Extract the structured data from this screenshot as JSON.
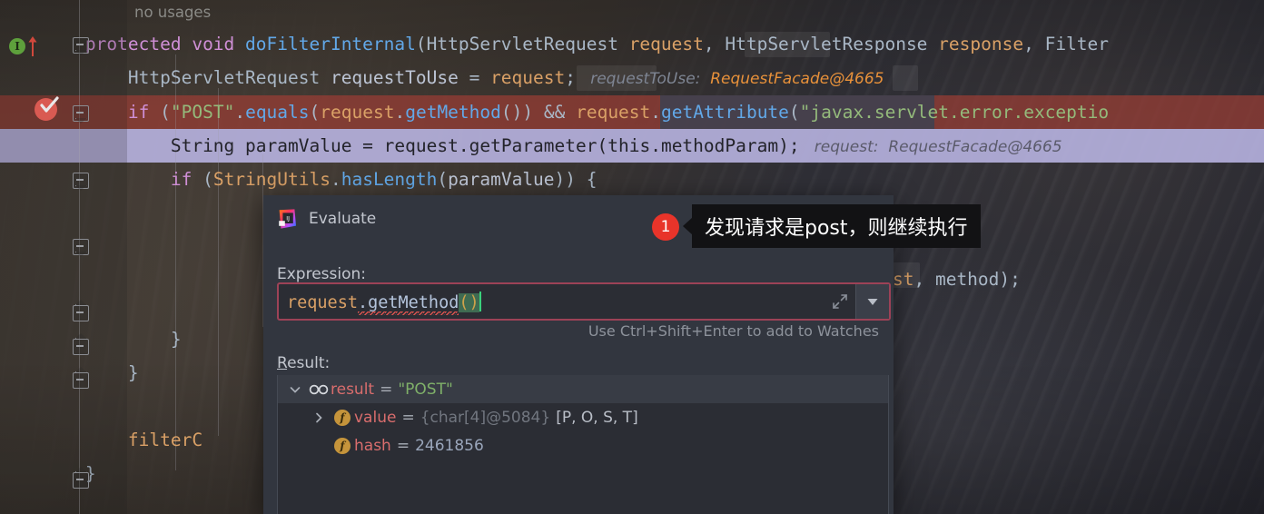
{
  "editor": {
    "inlay_no_usages": "no usages",
    "lines": [
      {
        "id": "signature",
        "segments": [
          {
            "t": "        ",
            "c": "ind"
          },
          {
            "t": "protected ",
            "c": "kw"
          },
          {
            "t": "void ",
            "c": "kw"
          },
          {
            "t": "doFilterInternal",
            "c": "fn"
          },
          {
            "t": "(",
            "c": "punct"
          },
          {
            "t": "HttpServletRequest ",
            "c": "type"
          },
          {
            "t": "request",
            "c": "param"
          },
          {
            "t": ", ",
            "c": "punct"
          },
          {
            "t": "HttpServletResponse ",
            "c": "type"
          },
          {
            "t": "response",
            "c": "param"
          },
          {
            "t": ", ",
            "c": "punct"
          },
          {
            "t": "Filter",
            "c": "type"
          }
        ]
      },
      {
        "id": "requestToUse",
        "segments": [
          {
            "t": "            ",
            "c": "ind"
          },
          {
            "t": "HttpServletRequest ",
            "c": "type"
          },
          {
            "t": "requestToUse ",
            "c": "plain"
          },
          {
            "t": "= ",
            "c": "punct"
          },
          {
            "t": "request",
            "c": "param"
          },
          {
            "t": ";",
            "c": "punct"
          },
          {
            "t": "   requestToUse:  ",
            "c": "hint"
          },
          {
            "t": "RequestFacade@4665",
            "c": "hintval"
          }
        ]
      },
      {
        "id": "if-post",
        "segments": [
          {
            "t": "            ",
            "c": "ind"
          },
          {
            "t": "if ",
            "c": "kw"
          },
          {
            "t": "(",
            "c": "punct"
          },
          {
            "t": "\"POST\"",
            "c": "str"
          },
          {
            "t": ".",
            "c": "punct"
          },
          {
            "t": "equals",
            "c": "fn"
          },
          {
            "t": "(",
            "c": "punct"
          },
          {
            "t": "request",
            "c": "param"
          },
          {
            "t": ".",
            "c": "punct"
          },
          {
            "t": "getMethod",
            "c": "fn"
          },
          {
            "t": "()) ",
            "c": "punct"
          },
          {
            "t": "&& ",
            "c": "punct"
          },
          {
            "t": "request",
            "c": "param"
          },
          {
            "t": ".",
            "c": "punct"
          },
          {
            "t": "getAttribute",
            "c": "fn"
          },
          {
            "t": "(",
            "c": "punct"
          },
          {
            "t": "\"javax.servlet.error.exceptio",
            "c": "str"
          }
        ]
      },
      {
        "id": "paramValue",
        "segments": [
          {
            "t": "                ",
            "c": "ind"
          },
          {
            "t": "String ",
            "c": "type"
          },
          {
            "t": "paramValue ",
            "c": "plain"
          },
          {
            "t": "= ",
            "c": "punct"
          },
          {
            "t": "request",
            "c": "param"
          },
          {
            "t": ".",
            "c": "punct"
          },
          {
            "t": "getParameter",
            "c": "plain"
          },
          {
            "t": "(",
            "c": "punct"
          },
          {
            "t": "this",
            "c": "plain"
          },
          {
            "t": ".",
            "c": "punct"
          },
          {
            "t": "methodParam",
            "c": "plain"
          },
          {
            "t": ");",
            "c": "punct"
          },
          {
            "t": "   request:  ",
            "c": "hint"
          },
          {
            "t": "RequestFacade@4665",
            "c": "hintval2"
          }
        ]
      },
      {
        "id": "if-haslength",
        "segments": [
          {
            "t": "                ",
            "c": "ind"
          },
          {
            "t": "if ",
            "c": "kw"
          },
          {
            "t": "(",
            "c": "punct"
          },
          {
            "t": "StringUtils",
            "c": "param"
          },
          {
            "t": ".",
            "c": "punct"
          },
          {
            "t": "hasLength",
            "c": "fn"
          },
          {
            "t": "(",
            "c": "punct"
          },
          {
            "t": "paramValue",
            "c": "plain"
          },
          {
            "t": ")) {",
            "c": "punct"
          }
        ]
      },
      {
        "id": "brace-inner",
        "segments": [
          {
            "t": "                ",
            "c": "ind"
          },
          {
            "t": "}",
            "c": "punct"
          }
        ]
      },
      {
        "id": "brace-mid",
        "segments": [
          {
            "t": "            ",
            "c": "ind"
          },
          {
            "t": "}",
            "c": "punct"
          }
        ]
      },
      {
        "id": "filterchain",
        "segments": [
          {
            "t": "            ",
            "c": "ind"
          },
          {
            "t": "filterC",
            "c": "param"
          }
        ]
      },
      {
        "id": "brace-outer",
        "segments": [
          {
            "t": "        ",
            "c": "ind"
          },
          {
            "t": "}",
            "c": "punct"
          }
        ]
      }
    ],
    "right_fragment": {
      "text_before": "st",
      "text_after": ", method);"
    }
  },
  "dialog": {
    "title": "Evaluate",
    "expression_label": "Expression:",
    "expression_value": {
      "object": "request",
      "call": ".getMethod",
      "parens": "()"
    },
    "watch_hint": "Use Ctrl+Shift+Enter to add to Watches",
    "result_label": "Result:",
    "result_tree": [
      {
        "indent": 0,
        "twisty": "chevron-down",
        "icon": "watch-glasses",
        "name": "result",
        "eq": "=",
        "value": "\"POST\"",
        "value_kind": "string",
        "selected": true
      },
      {
        "indent": 1,
        "twisty": "chevron-right",
        "icon": "field",
        "name": "value",
        "eq": "=",
        "value_ref": "{char[4]@5084}",
        "value": "[P, O, S, T]",
        "value_kind": "array",
        "selected": false
      },
      {
        "indent": 1,
        "twisty": "",
        "icon": "field",
        "name": "hash",
        "eq": "=",
        "value": "2461856",
        "value_kind": "number",
        "selected": false
      }
    ]
  },
  "annotation": {
    "badge": "1",
    "text": "发现请求是post，则继续执行"
  },
  "colors": {
    "breakpoint_line": "#9a3d34",
    "execution_line": "#bbb6e5",
    "expression_border": "#9d4257",
    "badge_red": "#e8342a",
    "string_green": "#94ba7b",
    "param_orange": "#d9a066",
    "keyword_purple": "#cf8fd6",
    "method_blue": "#62a8e8",
    "field_icon_gold": "#c5943b"
  }
}
